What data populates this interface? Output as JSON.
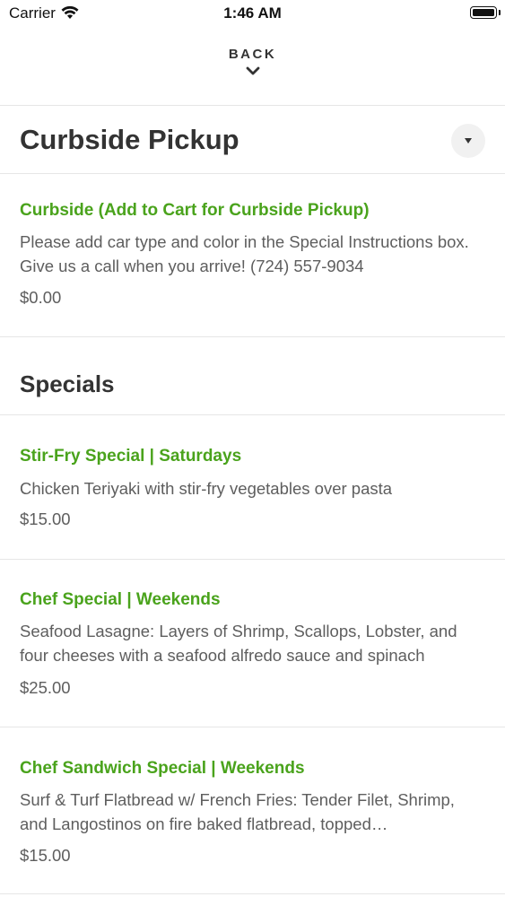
{
  "status_bar": {
    "carrier": "Carrier",
    "time": "1:46 AM"
  },
  "nav": {
    "back_label": "BACK"
  },
  "sections": [
    {
      "title": "Curbside Pickup",
      "items": [
        {
          "name": "Curbside (Add to Cart for Curbside Pickup)",
          "description": "Please add car type and color in the Special Instructions box. Give us a call when you arrive! (724) 557-9034",
          "price": "$0.00"
        }
      ]
    },
    {
      "title": "Specials",
      "items": [
        {
          "name": "Stir-Fry Special | Saturdays",
          "description": "Chicken Teriyaki with stir-fry vegetables over pasta",
          "price": "$15.00"
        },
        {
          "name": "Chef Special | Weekends",
          "description": "Seafood Lasagne: Layers of Shrimp, Scallops, Lobster, and four cheeses with a seafood alfredo sauce and spinach",
          "price": "$25.00"
        },
        {
          "name": "Chef Sandwich Special | Weekends",
          "description": "Surf & Turf Flatbread w/ French Fries: Tender Filet, Shrimp, and Langostinos on fire baked flatbread, topped…",
          "price": "$15.00"
        }
      ]
    }
  ],
  "colors": {
    "item_name": "#4aa31c",
    "text": "#333333",
    "muted": "#5e5e5e",
    "divider": "#e6e6e6"
  },
  "icons": {
    "wifi": "wifi-icon",
    "battery": "battery-icon",
    "back": "chevron-down-icon",
    "collapse": "caret-down-icon"
  }
}
